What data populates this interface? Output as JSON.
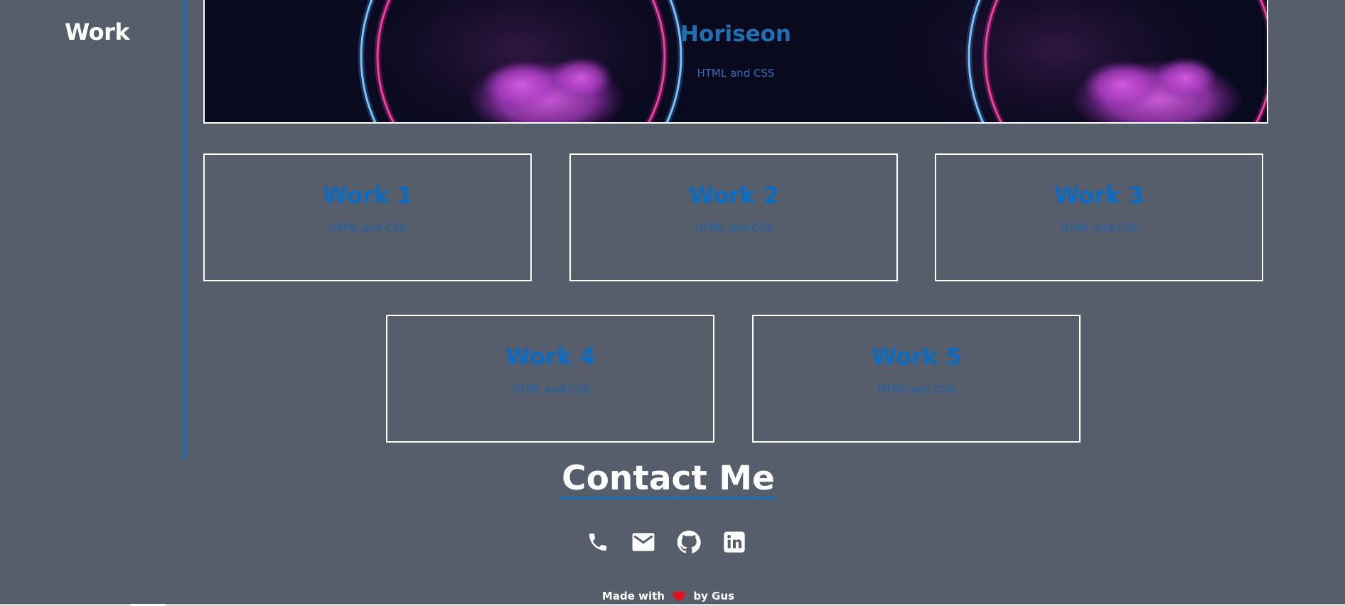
{
  "section": {
    "title": "Work"
  },
  "hero": {
    "title": "Horiseon",
    "subtitle": "HTML and CSS"
  },
  "works": [
    {
      "title": "Work 1",
      "subtitle": "HTML and CSS"
    },
    {
      "title": "Work 2",
      "subtitle": "HTML and CSS"
    },
    {
      "title": "Work 3",
      "subtitle": "HTML and CSS"
    },
    {
      "title": "Work 4",
      "subtitle": "HTML and CSS"
    },
    {
      "title": "Work 5",
      "subtitle": "HTML and CSS"
    }
  ],
  "contact": {
    "title": "Contact Me",
    "icons": [
      "phone-icon",
      "email-icon",
      "github-icon",
      "linkedin-icon"
    ]
  },
  "footer": {
    "made_with": "Made with",
    "by": "by Gus"
  },
  "colors": {
    "background": "#565e6b",
    "accent": "#1f6fb3",
    "card_title": "#0b6cc2",
    "heart": "#e0121f"
  }
}
